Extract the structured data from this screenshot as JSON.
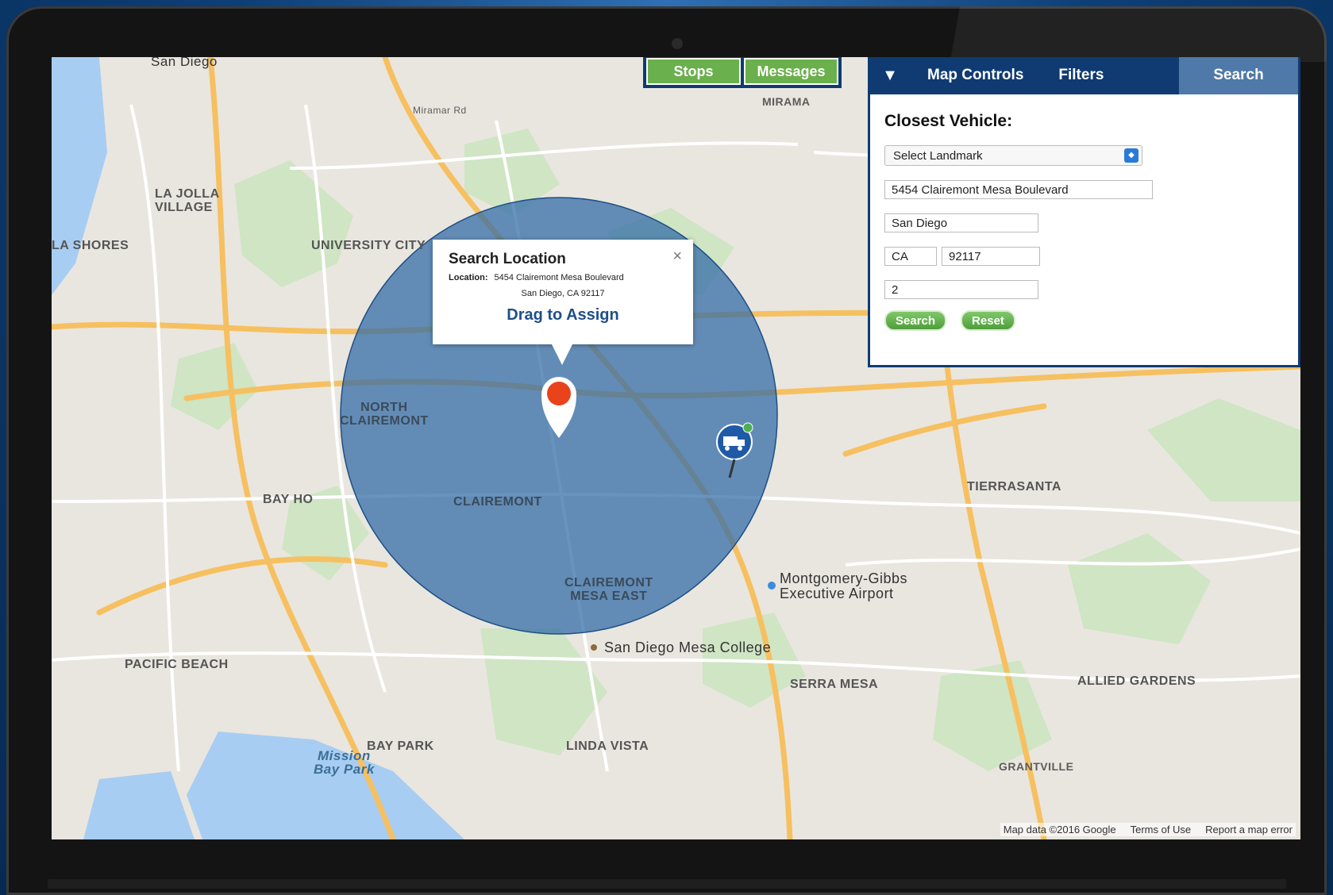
{
  "map_labels": {
    "san_diego_top": "San Diego",
    "miramar_rd": "Miramar Rd",
    "miramar": "MIRAMA",
    "la_jolla_village": "LA JOLLA\nVILLAGE",
    "la_shores": "LA SHORES",
    "university_city": "UNIVERSITY CITY",
    "north_clairemont": "NORTH\nCLAIREMONT",
    "clairemont": "CLAIREMONT",
    "clairemont_mesa_east": "CLAIREMONT\nMESA EAST",
    "bay_ho": "BAY HO",
    "tierrasanta": "TIERRASANTA",
    "pacific_beach": "PACIFIC BEACH",
    "serra_mesa": "SERRA MESA",
    "allied_gardens": "ALLIED GARDENS",
    "bay_park": "BAY PARK",
    "linda_vista": "LINDA VISTA",
    "mission_bay_park": "Mission\nBay Park",
    "montgomery_gibbs": "Montgomery-Gibbs\nExecutive Airport",
    "mesa_college": "San Diego Mesa College",
    "grantville": "GRANTVILLE"
  },
  "topnav": {
    "stops": "Stops",
    "messages": "Messages"
  },
  "panel": {
    "toggle": "▼",
    "tab_map_controls": "Map Controls",
    "tab_filters": "Filters",
    "tab_search": "Search",
    "title": "Closest Vehicle:",
    "select_landmark": "Select Landmark",
    "address": "5454 Clairemont Mesa Boulevard",
    "city": "San Diego",
    "state": "CA",
    "zip": "92117",
    "radius": "2",
    "search_button": "Search",
    "reset_button": "Reset"
  },
  "popup": {
    "title": "Search Location",
    "location_label": "Location:",
    "location_value": "5454 Clairemont Mesa Boulevard",
    "city_line": "San Diego, CA 92117",
    "drag_text": "Drag to Assign",
    "close": "×"
  },
  "footer": {
    "map_data": "Map data ©2016 Google",
    "terms": "Terms of Use",
    "report": "Report a map error"
  },
  "colors": {
    "nav_blue": "#0f3b72",
    "green": "#6ab04c",
    "circle_blue": "#2e6aa6",
    "marker": "#e8431b"
  },
  "icons": {
    "marker": "search-location-pin",
    "vehicle": "truck-icon"
  }
}
